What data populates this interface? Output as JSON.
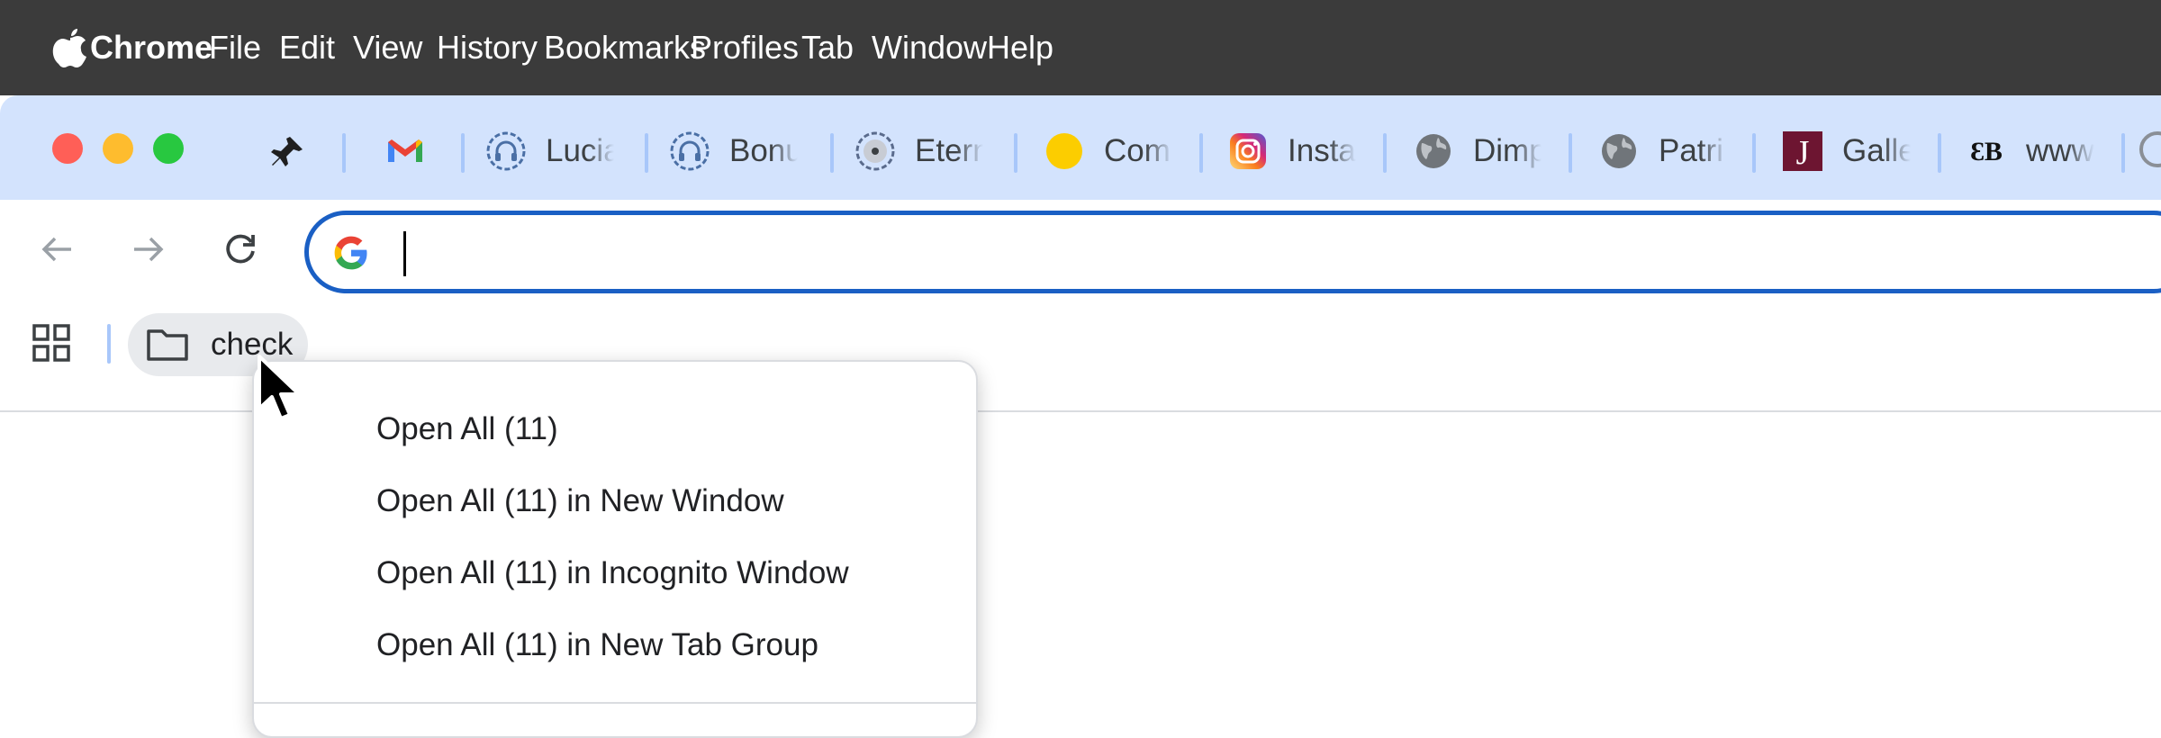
{
  "menubar": {
    "app_name": "Chrome",
    "items": [
      "File",
      "Edit",
      "View",
      "History",
      "Bookmarks",
      "Profiles",
      "Tab",
      "Window",
      "Help"
    ],
    "background": "#3b3b3b"
  },
  "tabs": [
    {
      "icon": "pin-icon",
      "title": ""
    },
    {
      "icon": "gmail-icon",
      "title": ""
    },
    {
      "icon": "headphones-icon",
      "title": "Lucia"
    },
    {
      "icon": "headphones-icon",
      "title": "Bonus"
    },
    {
      "icon": "disc-icon",
      "title": "Eternal"
    },
    {
      "icon": "yellow-circle-icon",
      "title": "Com"
    },
    {
      "icon": "instagram-icon",
      "title": "Insta"
    },
    {
      "icon": "globe-icon",
      "title": "Dimp"
    },
    {
      "icon": "globe-icon",
      "title": "Patri"
    },
    {
      "icon": "j-logo-icon",
      "title": "Galle"
    },
    {
      "icon": "bb-logo-icon",
      "title": "www"
    }
  ],
  "toolbar": {
    "back_icon": "back-arrow-icon",
    "forward_icon": "forward-arrow-icon",
    "reload_icon": "reload-icon",
    "omnibox_value": "",
    "omnibox_icon": "google-g-icon"
  },
  "bookmarks_bar": {
    "apps_icon": "apps-grid-icon",
    "folder_label": "check",
    "folder_icon": "folder-icon"
  },
  "context_menu": {
    "items": [
      "Open All (11)",
      "Open All (11) in New Window",
      "Open All (11) in Incognito Window",
      "Open All (11) in New Tab Group"
    ]
  },
  "colors": {
    "tabstrip": "#d3e3fd",
    "omnibox_border": "#1a5fc4",
    "traffic_close": "#ff5f57",
    "traffic_minimize": "#febc2e",
    "traffic_zoom": "#28c840"
  }
}
